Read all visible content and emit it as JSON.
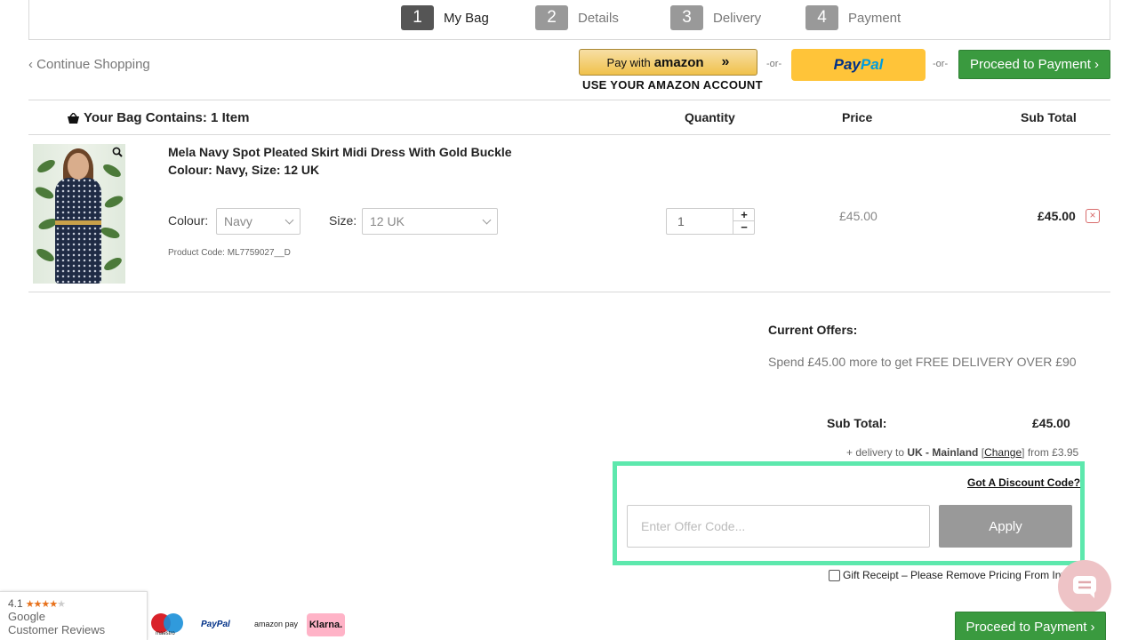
{
  "steps": [
    {
      "num": "1",
      "label": "My Bag"
    },
    {
      "num": "2",
      "label": "Details"
    },
    {
      "num": "3",
      "label": "Delivery"
    },
    {
      "num": "4",
      "label": "Payment"
    }
  ],
  "top_actions": {
    "continue_label": "‹ Continue Shopping",
    "amazon_prefix": "Pay with",
    "amazon_brand": "amazon",
    "amazon_chevrons": "»",
    "amazon_caption": "USE YOUR AMAZON ACCOUNT",
    "or_text": "-or-",
    "paypal_part1": "Pay",
    "paypal_part2": "Pal",
    "proceed_label": "Proceed to Payment ›"
  },
  "table_header": {
    "title": "Your Bag Contains: 1 Item",
    "quantity": "Quantity",
    "price": "Price",
    "subtotal": "Sub Total"
  },
  "product": {
    "name": "Mela Navy Spot Pleated Skirt Midi Dress With Gold Buckle",
    "variant": "Colour: Navy, Size: 12 UK",
    "colour_label": "Colour:",
    "colour_value": "Navy",
    "size_label": "Size:",
    "size_value": "12 UK",
    "code": "Product Code: ML7759027__D",
    "quantity": "1",
    "plus": "+",
    "minus": "−",
    "price": "£45.00",
    "line_total": "£45.00",
    "remove": "×"
  },
  "offers": {
    "title": "Current Offers:",
    "text": "Spend £45.00 more to get FREE DELIVERY OVER £90"
  },
  "totals": {
    "subtotal_label": "Sub Total:",
    "subtotal_value": "£45.00",
    "delivery_prefix": "+ delivery to",
    "delivery_region": "UK - Mainland",
    "delivery_open": "[",
    "delivery_change": "Change",
    "delivery_close": "]",
    "delivery_suffix": "from £3.95"
  },
  "discount": {
    "link": "Got A Discount Code?",
    "placeholder": "Enter Offer Code...",
    "apply": "Apply"
  },
  "gift": {
    "label": "Gift Receipt – Please Remove Pricing From Invo"
  },
  "google": {
    "rating": "4.1",
    "stars_full": "★★★★",
    "stars_empty": "★",
    "line1": "Google",
    "line2": "Customer Reviews"
  },
  "payment_logos": {
    "maestro": "maestro",
    "paypal": "PayPal",
    "amazon": "amazon pay",
    "klarna": "Klarna."
  },
  "colors": {
    "accent_green": "#3a9a3f",
    "highlight_border": "#5de8ad",
    "paypal_yellow": "#ffc439",
    "remove_red": "#d86b6b"
  }
}
